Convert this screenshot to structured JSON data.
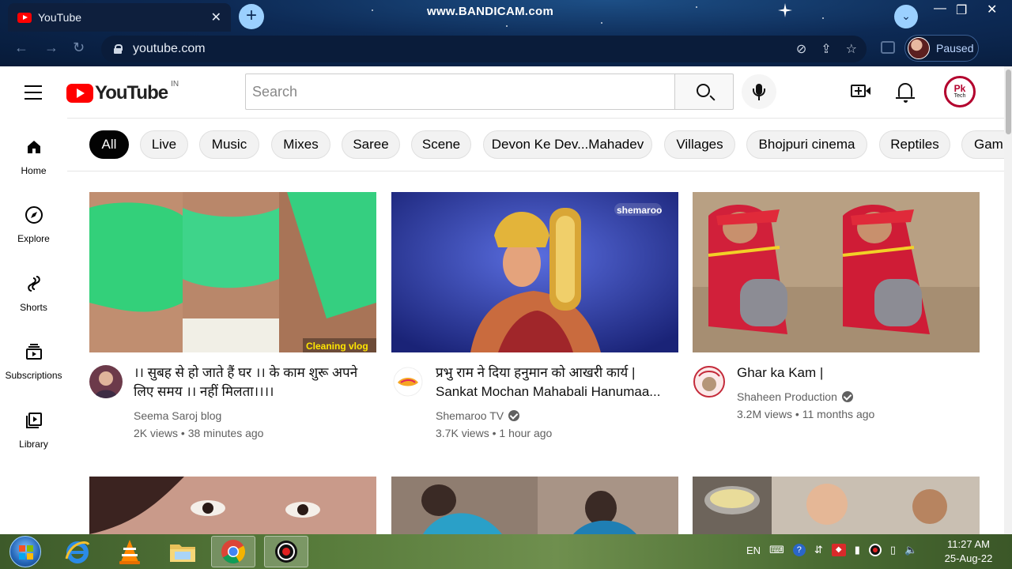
{
  "browser": {
    "tab_title": "YouTube",
    "url": "youtube.com",
    "recorder_watermark": "www.BANDICAM.com",
    "profile_status": "Paused"
  },
  "youtube": {
    "logo_text": "YouTube",
    "country_code": "IN",
    "search_placeholder": "Search",
    "avatar_text": "Pk",
    "avatar_subtext": "Tech",
    "sidebar": [
      {
        "label": "Home",
        "icon": "home-icon"
      },
      {
        "label": "Explore",
        "icon": "compass-icon"
      },
      {
        "label": "Shorts",
        "icon": "shorts-icon"
      },
      {
        "label": "Subscriptions",
        "icon": "subscriptions-icon"
      },
      {
        "label": "Library",
        "icon": "library-icon"
      }
    ],
    "chips": [
      "All",
      "Live",
      "Music",
      "Mixes",
      "Saree",
      "Scene",
      "Devon Ke Dev...Mahadev",
      "Villages",
      "Bhojpuri cinema",
      "Reptiles",
      "Gam"
    ],
    "videos": [
      {
        "title": "।। सुबह से हो जाते हैं घर ।। के काम शुरू अपने लिए समय ।। नहीं मिलता।।।।",
        "thumb_caption": "Cleaning vlog",
        "channel": "Seema Saroj blog",
        "verified": false,
        "views": "2K views",
        "age": "38 minutes ago"
      },
      {
        "title": "प्रभु राम ने दिया हनुमान को आखरी कार्य | Sankat Mochan Mahabali Hanumaa...",
        "thumb_caption": "shemaroo",
        "channel": "Shemaroo TV",
        "verified": true,
        "views": "3.7K views",
        "age": "1 hour ago"
      },
      {
        "title": "Ghar ka Kam |",
        "channel": "Shaheen Production",
        "verified": true,
        "views": "3.2M views",
        "age": "11 months ago"
      }
    ]
  },
  "taskbar": {
    "language": "EN",
    "time": "11:27 AM",
    "date": "25-Aug-22"
  }
}
